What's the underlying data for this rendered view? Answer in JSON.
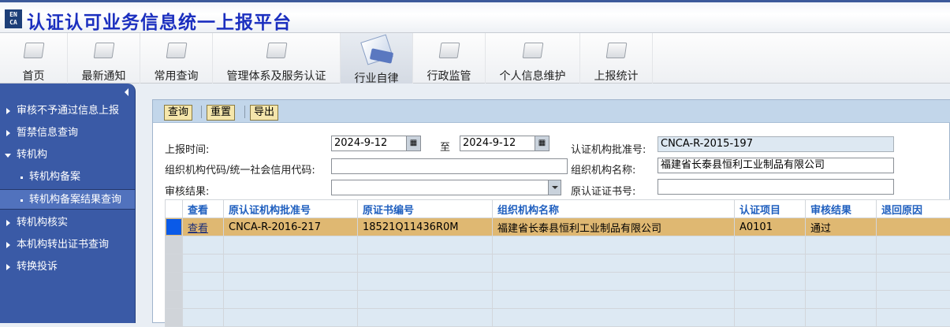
{
  "app": {
    "logo_text": "CNCA",
    "title": "认证认可业务信息统一上报平台"
  },
  "nav": [
    {
      "label": "首页"
    },
    {
      "label": "最新通知"
    },
    {
      "label": "常用查询"
    },
    {
      "label": "管理体系及服务认证"
    },
    {
      "label": "行业自律",
      "active": true
    },
    {
      "label": "行政监管"
    },
    {
      "label": "个人信息维护"
    },
    {
      "label": "上报统计"
    }
  ],
  "sidebar": {
    "items": [
      {
        "label": "审核不予通过信息上报"
      },
      {
        "label": "暂禁信息查询"
      },
      {
        "label": "转机构"
      },
      {
        "label": "转机构备案"
      },
      {
        "label": "转机构备案结果查询"
      },
      {
        "label": "转机构核实"
      },
      {
        "label": "本机构转出证书查询"
      },
      {
        "label": "转换投诉"
      }
    ]
  },
  "toolbar": {
    "query": "查询",
    "reset": "重置",
    "export": "导出"
  },
  "form": {
    "report_time_label": "上报时间:",
    "date_from": "2024-9-12",
    "to_label": "至",
    "date_to": "2024-9-12",
    "approval_no_label": "认证机构批准号:",
    "approval_no": "CNCA-R-2015-197",
    "org_code_label": "组织机构代码/统一社会信用代码:",
    "org_code": "",
    "org_name_label": "组织机构名称:",
    "org_name": "福建省长泰县恒利工业制品有限公司",
    "audit_result_label": "审核结果:",
    "audit_result": "",
    "orig_cert_label": "原认证证书号:",
    "orig_cert": ""
  },
  "table": {
    "headers": [
      "查看",
      "原认证机构批准号",
      "原证书编号",
      "组织机构名称",
      "认证项目",
      "审核结果",
      "退回原因"
    ],
    "rows": [
      {
        "view": "查看",
        "orig_approval": "CNCA-R-2016-217",
        "orig_cert": "18521Q11436R0M",
        "org_name": "福建省长泰县恒利工业制品有限公司",
        "project": "A0101",
        "result": "通过",
        "reason": ""
      }
    ]
  }
}
